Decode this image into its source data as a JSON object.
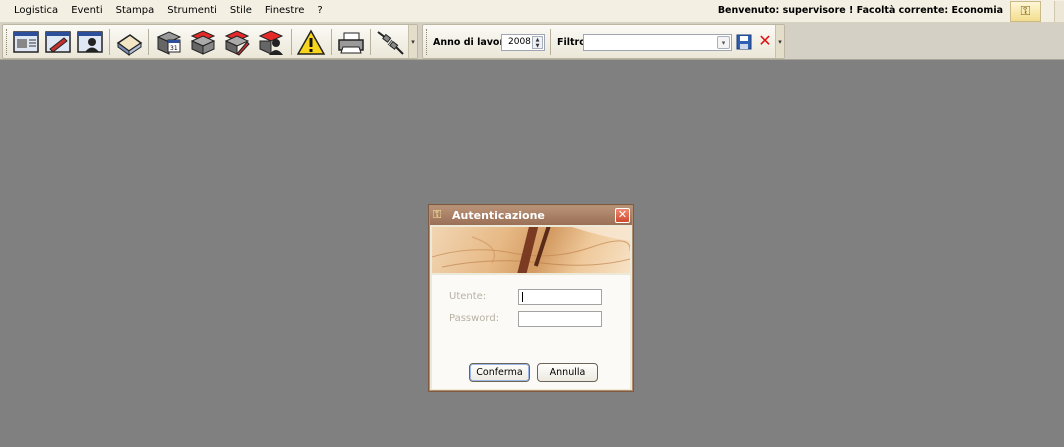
{
  "menu": {
    "items": [
      "Logistica",
      "Eventi",
      "Stampa",
      "Strumenti",
      "Stile",
      "Finestre",
      "?"
    ],
    "welcome": "Benvenuto: supervisore ! Facoltà corrente: Economia"
  },
  "toolbar": {
    "buttons": [
      {
        "icon": "window-list-icon"
      },
      {
        "icon": "window-edit-icon"
      },
      {
        "icon": "window-person-icon"
      },
      {
        "icon": "book-icon"
      },
      {
        "icon": "calendar-stack-icon"
      },
      {
        "icon": "red-stack-icon"
      },
      {
        "icon": "red-stack-edit-icon"
      },
      {
        "icon": "red-stack-person-icon"
      },
      {
        "icon": "warning-icon"
      },
      {
        "icon": "printer-icon"
      },
      {
        "icon": "disconnect-icon"
      }
    ]
  },
  "filter_bar": {
    "year_label": "Anno di lavoro:",
    "year_value": "2008",
    "filter_label": "Filtro",
    "filter_value": ""
  },
  "dialog": {
    "title": "Autenticazione",
    "user_label": "Utente:",
    "password_label": "Password:",
    "user_value": "",
    "password_value": "",
    "confirm_label": "Conferma",
    "cancel_label": "Annulla"
  }
}
